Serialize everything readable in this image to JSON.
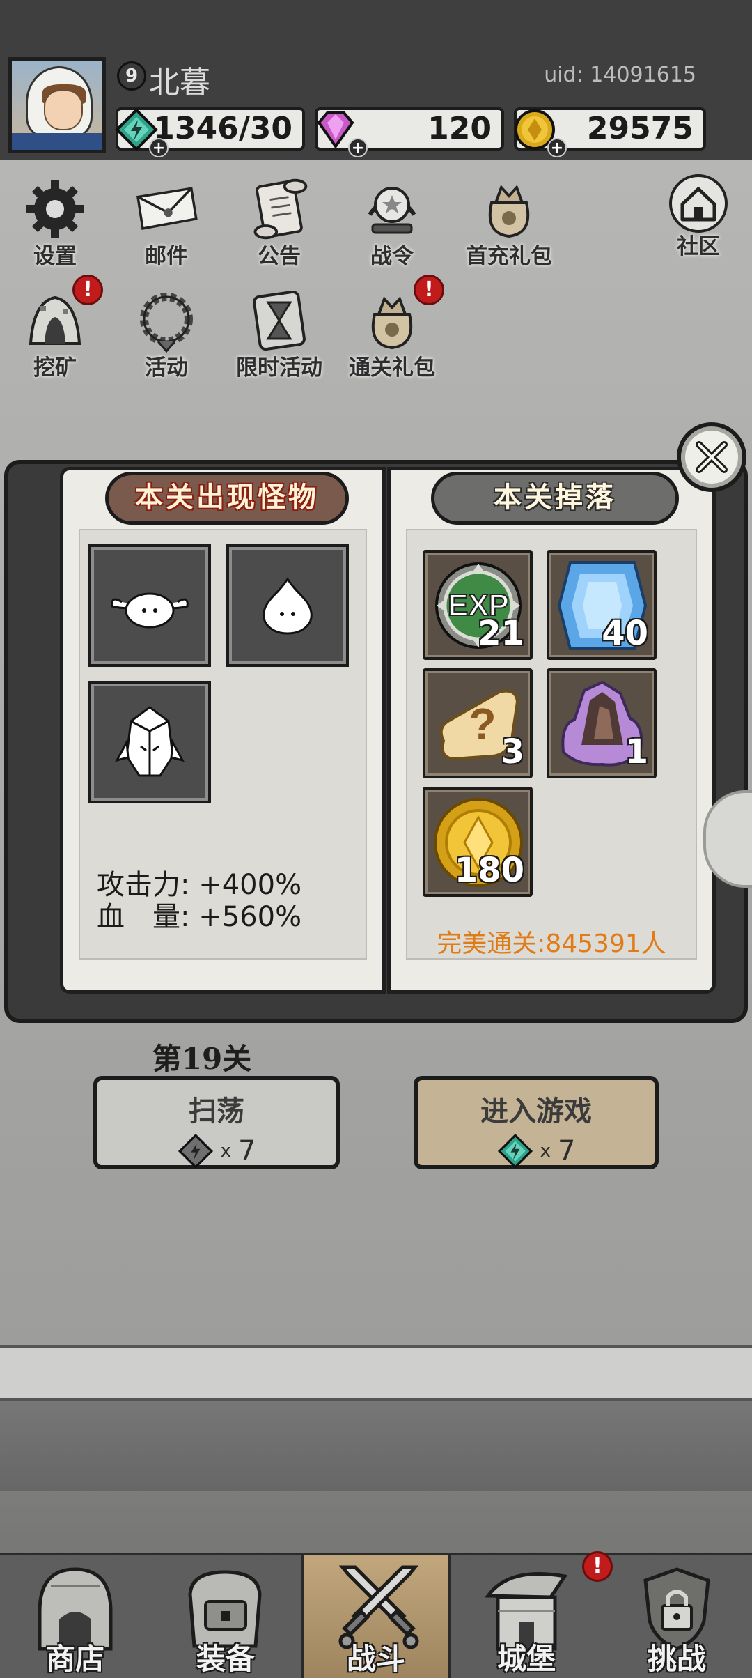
{
  "player": {
    "name": "北暮",
    "level": "9",
    "uid": "uid: 14091615"
  },
  "resources": {
    "energy": "1346/30",
    "gems": "120",
    "coins": "29575"
  },
  "menu": {
    "row1": [
      {
        "label": "设置",
        "icon": "gear-icon"
      },
      {
        "label": "邮件",
        "icon": "mail-icon"
      },
      {
        "label": "公告",
        "icon": "scroll-icon"
      },
      {
        "label": "战令",
        "icon": "battle-pass-icon"
      },
      {
        "label": "首充礼包",
        "icon": "gift-bag-icon"
      },
      {
        "label": "社区",
        "icon": "home-icon"
      }
    ],
    "row2": [
      {
        "label": "挖矿",
        "icon": "mine-icon",
        "badge": "!"
      },
      {
        "label": "活动",
        "icon": "wreath-icon"
      },
      {
        "label": "限时活动",
        "icon": "hourglass-icon"
      },
      {
        "label": "通关礼包",
        "icon": "gift-bag-icon",
        "badge": "!"
      }
    ]
  },
  "book": {
    "left_title": "本关出现怪物",
    "right_title": "本关掉落",
    "monsters": [
      "bunny-monster-icon",
      "blob-monster-icon",
      "armor-monster-icon"
    ],
    "attack_label": "攻击力:",
    "attack_value": "+400%",
    "hp_label": "血　量:",
    "hp_value": "+560%",
    "drops": [
      {
        "icon": "exp-icon",
        "qty": "21",
        "icon_text": "EXP"
      },
      {
        "icon": "blue-gem-icon",
        "qty": "40"
      },
      {
        "icon": "mystery-scroll-icon",
        "qty": "3",
        "icon_text": "?"
      },
      {
        "icon": "crystal-ore-icon",
        "qty": "1"
      },
      {
        "icon": "gold-coin-icon",
        "qty": "180"
      }
    ],
    "perfect_clear": "完美通关:845391人"
  },
  "stage": {
    "title": "第19关",
    "sweep_label": "扫荡",
    "sweep_cost": "7",
    "enter_label": "进入游戏",
    "enter_cost": "7",
    "times": "x"
  },
  "nav": [
    {
      "label": "商店",
      "icon": "shop-icon"
    },
    {
      "label": "装备",
      "icon": "backpack-icon"
    },
    {
      "label": "战斗",
      "icon": "crossed-swords-icon",
      "active": true
    },
    {
      "label": "城堡",
      "icon": "castle-icon",
      "badge": "!"
    },
    {
      "label": "挑战",
      "icon": "shield-lock-icon"
    }
  ],
  "colors": {
    "accent_orange": "#e07b16",
    "alert_red": "#c21b1b",
    "active_tab": "#b49a70"
  }
}
